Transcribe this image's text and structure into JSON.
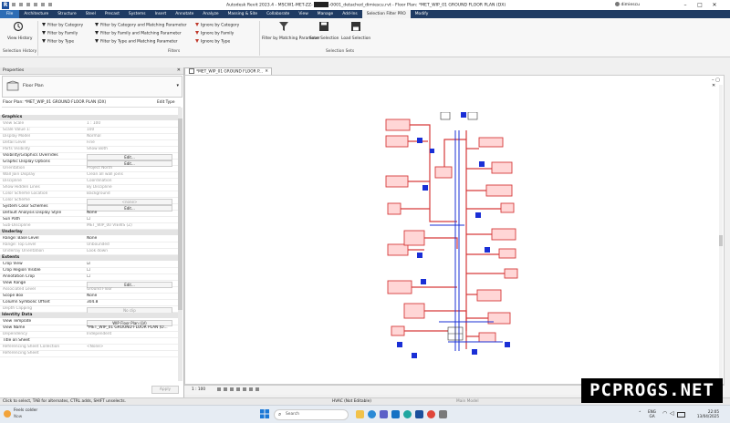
{
  "titlebar": {
    "title": "Autodesk Revit 2023.4 - MSCW1-MET-ZZ-",
    "title_tail": "-0001_detached_dimiescu.rvt - Floor Plan: *MET_WIP_01 GROUND FLOOR PLAN (DX)",
    "user": "dimiescu"
  },
  "menu": [
    "File",
    "Architecture",
    "Structure",
    "Steel",
    "Precast",
    "Systems",
    "Insert",
    "Annotate",
    "Analyze",
    "Massing & Site",
    "Collaborate",
    "View",
    "Manage",
    "Add-Ins",
    "Selection Filter PRO",
    "Modify"
  ],
  "ribbon": {
    "view_history": "View History",
    "selection_history_group": "Selection History",
    "filters_group": "Filters",
    "selection_sets_group": "Selection Sets",
    "filter_col1": [
      "Filter by Category",
      "Filter by Family",
      "Filter by Type"
    ],
    "filter_col2": [
      "Filter by Category and Matching Parameter",
      "Filter by Family and Matching Parameter",
      "Filter by Type and Matching Parameter"
    ],
    "ignore_col": [
      "Ignore by Category",
      "Ignore by Family",
      "Ignore by Type"
    ],
    "filter_matching": "Filter by Matching Parameter",
    "save_selection": "Save Selection",
    "load_selection": "Load Selection"
  },
  "properties": {
    "title": "Properties",
    "type_name": "Floor Plan",
    "instance_label": "Floor Plan: *MET_WIP_01 GROUND FLOOR PLAN (DX)",
    "edit_type": "Edit Type",
    "categories": {
      "graphics": "Graphics",
      "underlay": "Underlay",
      "extents": "Extents",
      "identity": "Identity Data"
    },
    "graphics_rows": [
      {
        "k": "View Scale",
        "v": "1 : 100",
        "grey": true
      },
      {
        "k": "Scale Value  1:",
        "v": "100",
        "grey": true
      },
      {
        "k": "Display Model",
        "v": "Normal",
        "grey": true
      },
      {
        "k": "Detail Level",
        "v": "Fine",
        "grey": true
      },
      {
        "k": "Parts Visibility",
        "v": "Show Both",
        "grey": true
      },
      {
        "k": "Visibility/Graphics Overrides",
        "btn": "Edit..."
      },
      {
        "k": "Graphic Display Options",
        "btn": "Edit..."
      },
      {
        "k": "Orientation",
        "v": "Project North",
        "grey": true
      },
      {
        "k": "Wall Join Display",
        "v": "Clean all wall joins",
        "grey": true
      },
      {
        "k": "Discipline",
        "v": "Coordination",
        "grey": true
      },
      {
        "k": "Show Hidden Lines",
        "v": "By Discipline",
        "grey": true
      },
      {
        "k": "Color Scheme Location",
        "v": "Background",
        "grey": true
      },
      {
        "k": "Color Scheme",
        "btn": "<none>",
        "grey": true
      },
      {
        "k": "System Color Schemes",
        "btn": "Edit..."
      },
      {
        "k": "Default Analysis Display Style",
        "v": "None"
      },
      {
        "k": "Sun Path",
        "v": "☐"
      },
      {
        "k": "Sub-Discipline",
        "v": "MET_WIP_00 VIEWS (Z)",
        "grey": true
      }
    ],
    "underlay_rows": [
      {
        "k": "Range: Base Level",
        "v": "None"
      },
      {
        "k": "Range: Top Level",
        "v": "Unbounded",
        "grey": true
      },
      {
        "k": "Underlay Orientation",
        "v": "Look down",
        "grey": true
      }
    ],
    "extents_rows": [
      {
        "k": "Crop View",
        "v": "☑"
      },
      {
        "k": "Crop Region Visible",
        "v": "☐"
      },
      {
        "k": "Annotation Crop",
        "v": "☐"
      },
      {
        "k": "View Range",
        "btn": "Edit..."
      },
      {
        "k": "Associated Level",
        "v": "Ground Floor",
        "grey": true
      },
      {
        "k": "Scope Box",
        "v": "None"
      },
      {
        "k": "Column Symbolic Offset",
        "v": "304.8"
      },
      {
        "k": "Depth Clipping",
        "btn": "No clip",
        "grey": true
      }
    ],
    "identity_rows": [
      {
        "k": "View Template",
        "btn": "WIP Floor Plan (LV)"
      },
      {
        "k": "View Name",
        "v": "*MET_WIP_01 GROUND FLOOR PLAN (D..."
      },
      {
        "k": "Dependency",
        "v": "Independent",
        "grey": true
      },
      {
        "k": "Title on Sheet",
        "v": ""
      },
      {
        "k": "Referencing Sheet Collection",
        "v": "<None>",
        "grey": true
      },
      {
        "k": "Referencing Sheet",
        "v": "",
        "grey": true
      }
    ],
    "apply": "Apply"
  },
  "view_tab": "*MET_WIP_01 GROUND FLOOR P...",
  "viewbar": {
    "scale": "1 : 100"
  },
  "statusbar": {
    "hint": "Click to select, TAB for alternates, CTRL adds, SHIFT unselects.",
    "workset": "HVAC (Not Editable)",
    "model": "Main Model"
  },
  "taskbar": {
    "weather_title": "Feels colder",
    "weather_sub": "Now",
    "search": "Search",
    "lang": "ENG",
    "region": "GA",
    "time": "22:05",
    "date": "13/04/2025"
  },
  "watermark": "PCPROGS.NET",
  "colors": {
    "menu": "#1f3b63",
    "duct": "#d63a3a",
    "pipe": "#1a2fd6"
  }
}
